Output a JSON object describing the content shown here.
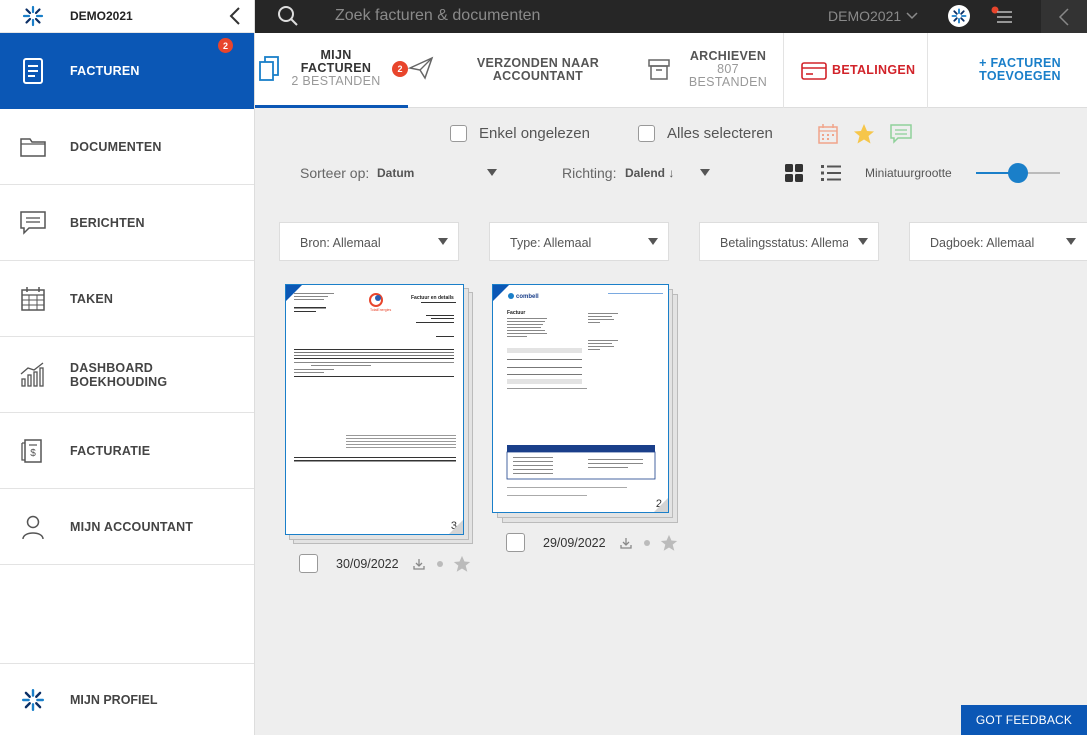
{
  "app": {
    "org": "DEMO2021"
  },
  "sidebar": {
    "items": [
      {
        "label": "FACTUREN",
        "icon": "invoice-icon",
        "badge": "2",
        "active": true
      },
      {
        "label": "DOCUMENTEN",
        "icon": "folder-icon"
      },
      {
        "label": "BERICHTEN",
        "icon": "message-icon"
      },
      {
        "label": "TAKEN",
        "icon": "calendar-icon"
      },
      {
        "label": "DASHBOARD BOEKHOUDING",
        "icon": "chart-icon"
      },
      {
        "label": "FACTURATIE",
        "icon": "billing-icon"
      },
      {
        "label": "MIJN ACCOUNTANT",
        "icon": "person-icon"
      }
    ],
    "profile": {
      "label": "MIJN PROFIEL"
    }
  },
  "topbar": {
    "search_placeholder": "Zoek facturen & documenten",
    "org_select": "DEMO2021"
  },
  "tabs": {
    "mijn": {
      "line1": "MIJN",
      "line2": "FACTUREN",
      "count": "2 BESTANDEN",
      "badge": "2"
    },
    "verzonden": {
      "line1": "VERZONDEN NAAR",
      "line2": "ACCOUNTANT"
    },
    "archieven": {
      "line1": "ARCHIEVEN",
      "line2": "807",
      "line3": "BESTANDEN"
    },
    "betalingen": {
      "label": "BETALINGEN"
    },
    "add": {
      "line1": "+ FACTUREN",
      "line2": "TOEVOEGEN"
    }
  },
  "filters": {
    "unread_label": "Enkel ongelezen",
    "select_all_label": "Alles selecteren",
    "sort_label": "Sorteer op:",
    "sort_value": "Datum",
    "direction_label": "Richting:",
    "direction_value": "Dalend ↓",
    "thumb_label": "Miniatuurgrootte",
    "thumb_size": 0.5,
    "dropdowns": [
      "Bron: Allemaal",
      "Type: Allemaal",
      "Betalingsstatus: Allemaal",
      "Dagboek: Allemaal"
    ]
  },
  "documents": [
    {
      "date": "30/09/2022",
      "pages": "3",
      "vendor": "TotalEnergies",
      "title": "Factuur en details"
    },
    {
      "date": "29/09/2022",
      "pages": "2",
      "vendor": "combell",
      "title": "Factuur"
    }
  ],
  "feedback": "GOT FEEDBACK",
  "colors": {
    "primary": "#0b57b5",
    "accent": "#1a7fc9",
    "badge": "#e8452c",
    "payments": "#d2232a",
    "topbar": "#262626"
  }
}
